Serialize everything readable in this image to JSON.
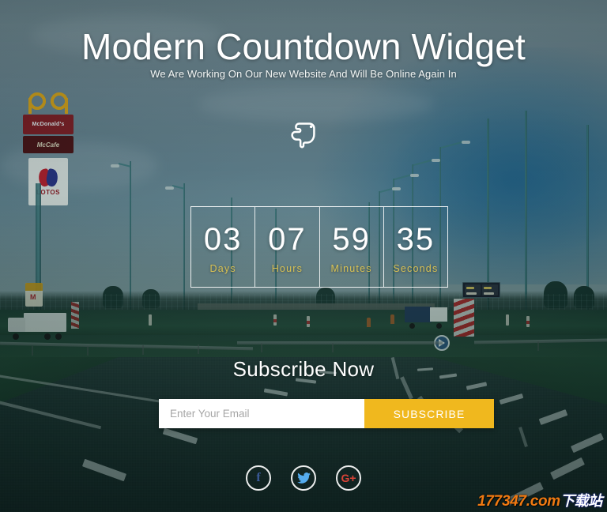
{
  "page": {
    "title": "Modern Countdown Widget",
    "subtitle": "We Are Working On Our New Website And Will Be Online Again In"
  },
  "pointer_icon": "pointing-hand-icon",
  "countdown": {
    "units": [
      {
        "value": "03",
        "label": "Days"
      },
      {
        "value": "07",
        "label": "Hours"
      },
      {
        "value": "59",
        "label": "Minutes"
      },
      {
        "value": "35",
        "label": "Seconds"
      }
    ]
  },
  "subscribe": {
    "heading": "Subscribe Now",
    "email_placeholder": "Enter Your Email",
    "email_value": "",
    "button_label": "SUBSCRIBE"
  },
  "social": {
    "items": [
      {
        "name": "facebook",
        "glyph": "f"
      },
      {
        "name": "twitter",
        "glyph": ""
      },
      {
        "name": "google-plus",
        "glyph": "G+"
      }
    ]
  },
  "watermark": {
    "domain": "177347.com",
    "suffix": "下载站"
  },
  "background": {
    "billboard": {
      "mcdonalds_label": "McDonald's",
      "mccafe_label": "McCafe",
      "lotos_label": "LOTOS"
    },
    "gas_sign_letter": "M"
  },
  "colors": {
    "accent_gold": "#f0b81e",
    "label_gold": "#d8c153",
    "text_white": "#ffffff",
    "road_teal": "#1d3d39",
    "sky_gray": "#7a939c",
    "facebook_blue": "#3b5b9b",
    "twitter_blue": "#55acee",
    "google_red": "#db4437",
    "watermark_orange": "#f07a12"
  }
}
